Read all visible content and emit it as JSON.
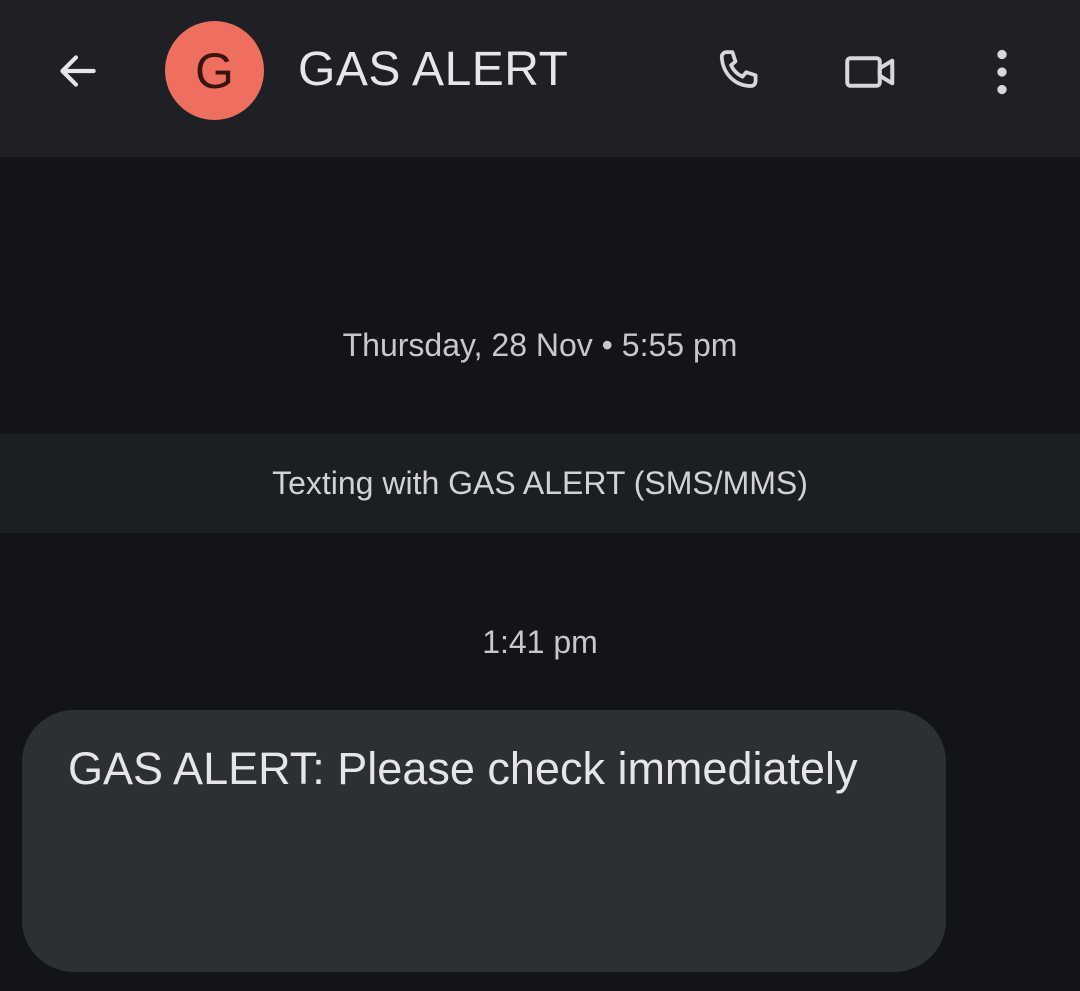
{
  "header": {
    "avatar_letter": "G",
    "title": "GAS ALERT",
    "avatar_color": "#ee6e5f",
    "icons": {
      "back": "arrow-left-icon",
      "call": "phone-icon",
      "video": "video-camera-icon",
      "more": "more-vertical-icon"
    }
  },
  "conversation": {
    "date_stamp": "Thursday, 28 Nov • 5:55 pm",
    "info_banner": "Texting with GAS ALERT (SMS/MMS)",
    "messages": [
      {
        "time": "1:41 pm",
        "text": "GAS ALERT: Please check immediately",
        "direction": "incoming"
      }
    ]
  },
  "colors": {
    "background": "#121419",
    "header_bg": "#1e2025",
    "bubble_bg": "#2c2f33"
  }
}
